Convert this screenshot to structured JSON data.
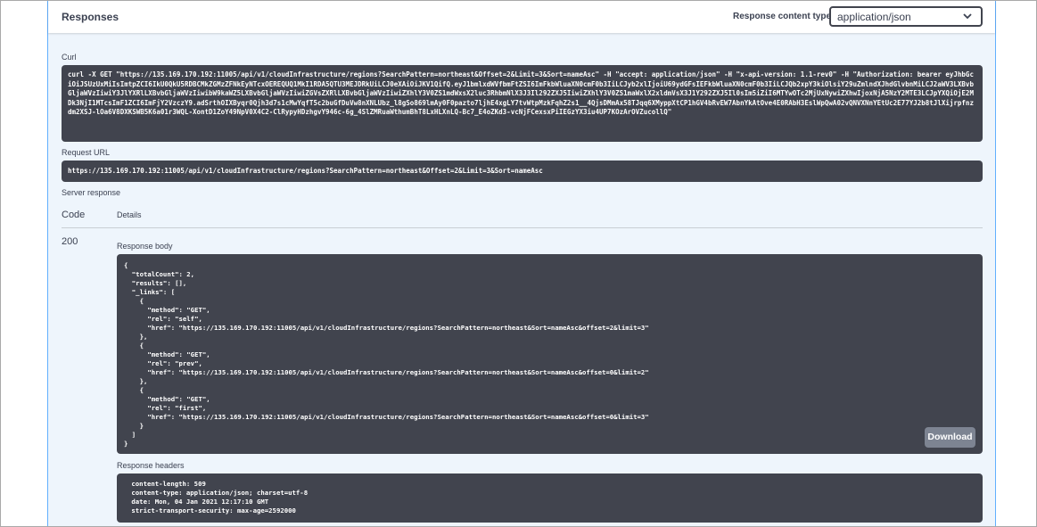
{
  "responses": {
    "title": "Responses",
    "content_type_label": "Response content type",
    "content_type_value": "application/json"
  },
  "curl": {
    "label": "Curl",
    "command": "curl -X GET \"https://135.169.170.192:11005/api/v1/cloudInfrastructure/regions?SearchPattern=northeast&Offset=2&Limit=3&Sort=nameAsc\" -H \"accept: application/json\" -H \"x-api-version: 1.1-rev0\" -H \"Authorization: bearer eyJhbGciOiJSUzUxMiIsImtpZCI6IkU0QkU5RDBCMkZGMzZFNkEyNTcxOEREQUQ1MkI1RDA5QTU3MEJDRkUiLCJ0eXAiOiJKV1QifQ.eyJ1bmlxdWVfbmFtZSI6ImFkbWluaXN0cmF0b3IiLCJyb2xlIjoiU69ydGFsIEFkbWluaXN0cmF0b3IiLCJQb2xpY3kiOlsiY29uZmlndXJhdGlvbnMiLCJ2aWV3LXBvbGljaWVzIiwiY3JlYXRlLXBvbGljaWVzIiwibW9kaWZ5LXBvbGljaWVzIiwiZGVsZXRlLXBvbGljaWVzIiwiZXhlY3V0ZS1mdWxsX2luc3RhbmNlX3J3Il292ZXJ5IiwiZXhlY3V0ZS1maWxlX2xldmVsX3J1Y292ZXJ5Il0sIm5iZiI6MTYwOTc2MjUxNywiZXhwIjoxNjA5NzY2MTE3LCJpYXQiOjE2MDk3NjI1MTcsImF1ZCI6ImFjY2VzczY9.adSrthOIXByqr0Qjh3d7s1cMwYqfT5c2buGfDuVw8nXNLUbz_l8gSo869lmAy0F0pazto7ljhE4xgLY7tvWtpMzkFqhZ2s1__4QjsDMmAx58TJqq6XMyppXtCP1hGV4bRvEW7AbnYkAtOve4E0RAbH3EslWpQwA02vQNVXNnYEtUc2E77YJ2b8tJlXijrpfnzdm2XSJ-lOa6V8DXKSWB5K6a01r3WQL-XontD1ZoY49NpV0X4C2-ClRypyHDzhgvY946c-6g_4SlZMRuaWthumBhT8LxHLXnLQ-Bc7_E4oZKd3-vcNjFCexsxPiIEGzYX3iu4UP7KOzArOVZucollQ\""
  },
  "request_url": {
    "label": "Request URL",
    "value": "https://135.169.170.192:11005/api/v1/cloudInfrastructure/regions?SearchPattern=northeast&Offset=2&Limit=3&Sort=nameAsc"
  },
  "server_response": {
    "label": "Server response",
    "code_header": "Code",
    "details_header": "Details",
    "code": "200",
    "body_label": "Response body",
    "body": "{\n  \"totalCount\": 2,\n  \"results\": [],\n  \"_links\": [\n    {\n      \"method\": \"GET\",\n      \"rel\": \"self\",\n      \"href\": \"https://135.169.170.192:11005/api/v1/cloudInfrastructure/regions?SearchPattern=northeast&Sort=nameAsc&offset=2&limit=3\"\n    },\n    {\n      \"method\": \"GET\",\n      \"rel\": \"prev\",\n      \"href\": \"https://135.169.170.192:11005/api/v1/cloudInfrastructure/regions?SearchPattern=northeast&Sort=nameAsc&offset=0&limit=2\"\n    },\n    {\n      \"method\": \"GET\",\n      \"rel\": \"first\",\n      \"href\": \"https://135.169.170.192:11005/api/v1/cloudInfrastructure/regions?SearchPattern=northeast&Sort=nameAsc&offset=0&limit=3\"\n    }\n  ]\n}",
    "download_label": "Download",
    "headers_label": "Response headers",
    "headers": " content-length: 509\n content-type: application/json; charset=utf-8\n date: Mon, 04 Jan 2021 12:17:10 GMT\n strict-transport-security: max-age=2592000"
  },
  "colors": {
    "code_background": "#41444e",
    "panel_background": "#eef5fc",
    "panel_border": "#61affe",
    "download_button": "#7d8492"
  },
  "icons": {
    "select_chevron": "chevron-down-icon"
  }
}
